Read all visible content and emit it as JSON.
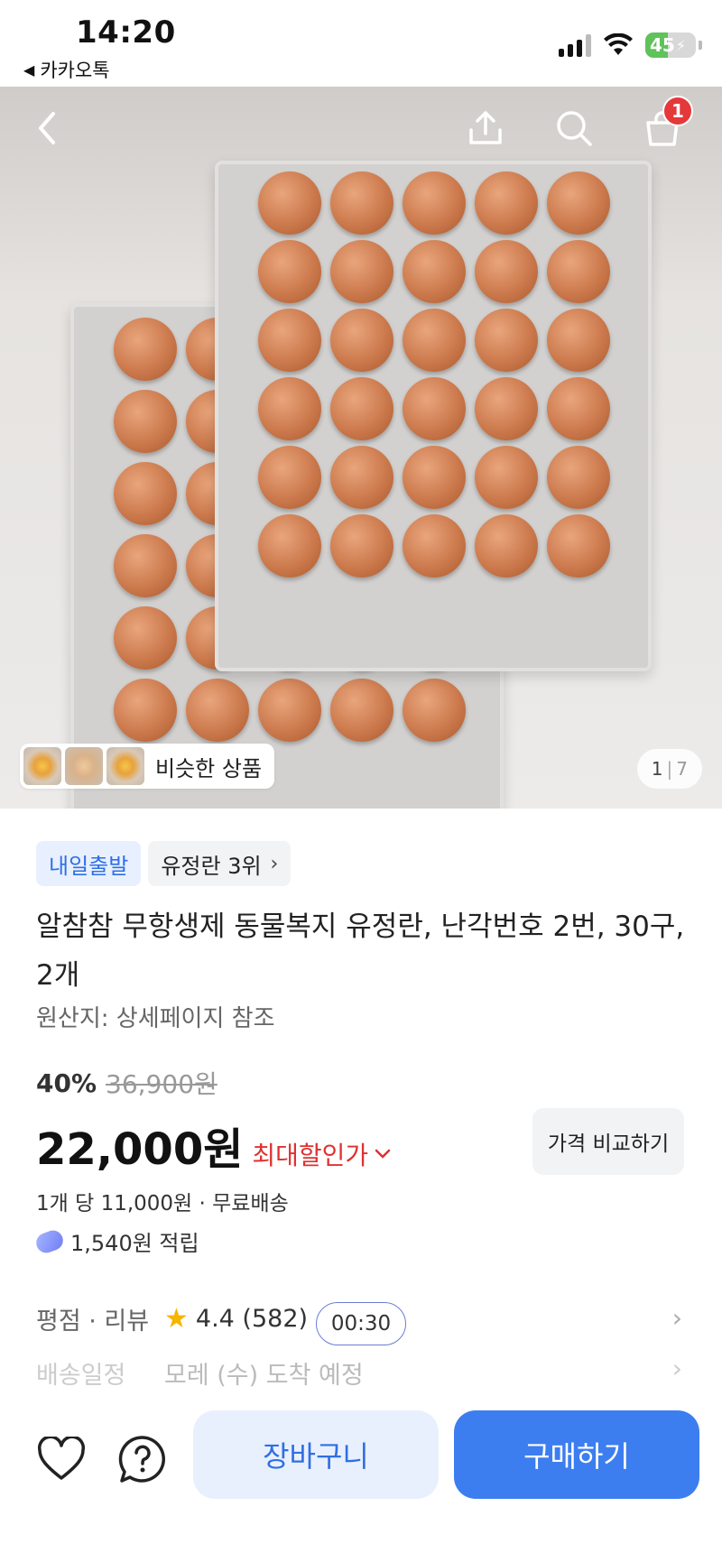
{
  "status_bar": {
    "time": "14:20",
    "back_app": "카카오톡",
    "battery_level": "45"
  },
  "hero": {
    "cart_count": "1",
    "similar_label": "비슷한 상품",
    "pager_current": "1",
    "pager_sep": "|",
    "pager_total": "7",
    "icons": [
      "back-chevron-icon",
      "share-icon",
      "search-icon",
      "cart-icon"
    ]
  },
  "product": {
    "badge_delivery": "내일출발",
    "badge_rank": "유정란 3위",
    "title": "알참참 무항생제 동물복지 유정란, 난각번호 2번, 30구, 2개",
    "origin": "원산지: 상세페이지 참조",
    "discount_percent": "40%",
    "original_price": "36,900원",
    "price": "22,000원",
    "max_discount_label": "최대할인가",
    "compare_button": "가격 비교하기",
    "unit_price": "1개 당 11,000원 · 무료배송",
    "points": "1,540원 적립"
  },
  "review": {
    "label": "평점 · 리뷰",
    "rating": "4.4 (582)",
    "timer": "00:30"
  },
  "shipping": {
    "label": "배송일정",
    "value": "모레 (수) 도착 예정"
  },
  "bottom_bar": {
    "cart_button": "장바구니",
    "buy_button": "구매하기"
  },
  "colors": {
    "accent": "#3c7ef0",
    "sale_red": "#e03131",
    "badge_red": "#e5383b"
  }
}
